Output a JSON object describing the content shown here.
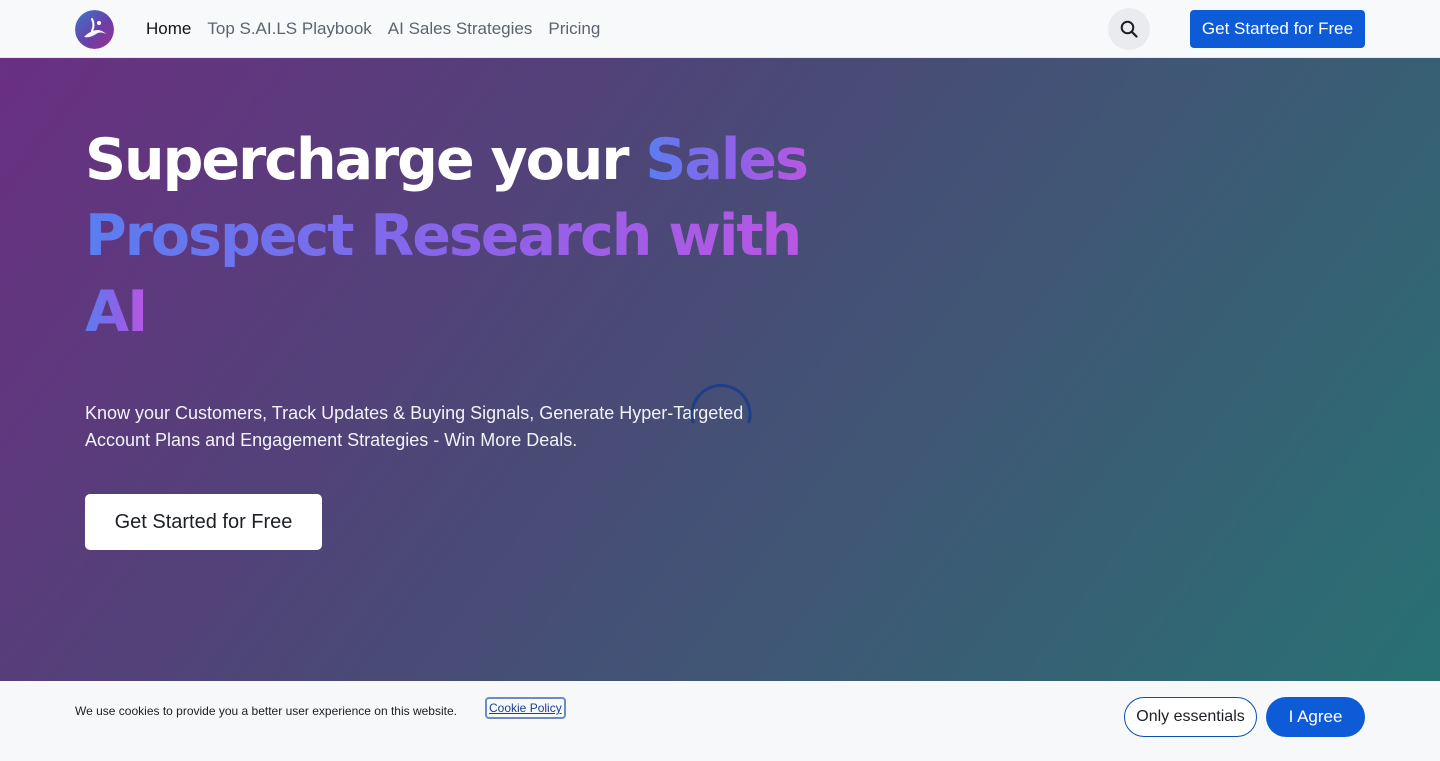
{
  "header": {
    "logo_icon": "brand-logo-icon",
    "nav": [
      {
        "label": "Home",
        "active": true
      },
      {
        "label": "Top S.AI.LS Playbook",
        "active": false
      },
      {
        "label": "AI Sales Strategies",
        "active": false
      },
      {
        "label": "Pricing",
        "active": false
      }
    ],
    "search_icon": "search-icon",
    "cta_label": "Get Started for Free"
  },
  "hero": {
    "title_white": "Supercharge your ",
    "title_highlight_1": "Sales",
    "title_highlight_2": "Prospect Research with",
    "title_highlight_3": "AI",
    "subtitle_line1": "Know your Customers, Track Updates & Buying Signals, Generate Hyper-Targeted",
    "subtitle_line2": "Account Plans and Engagement Strategies - Win More Deals.",
    "cta_label": "Get Started for Free",
    "loading_icon": "loading-spinner-icon"
  },
  "cookie_bar": {
    "text": "We use cookies to provide you a better user experience on this website.",
    "link_label": "Cookie Policy",
    "essentials_label": "Only essentials",
    "agree_label": "I Agree"
  },
  "colors": {
    "primary": "#0d5bd7",
    "gradient_start": "#6a2f82",
    "gradient_end": "#287173",
    "highlight_blue": "#5a7ef0",
    "highlight_purple": "#b857e3"
  }
}
